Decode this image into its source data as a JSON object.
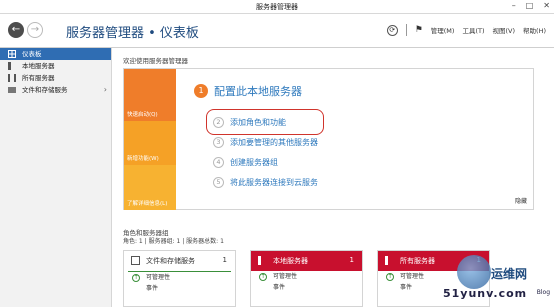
{
  "window": {
    "title": "服务器管理器",
    "controls": [
      "–",
      "□",
      "✕"
    ]
  },
  "header": {
    "back": "←",
    "forward": "→",
    "breadcrumb": "服务器管理器 • 仪表板",
    "menus": [
      "管理(M)",
      "工具(T)",
      "视图(V)",
      "帮助(H)"
    ]
  },
  "sidebar": {
    "items": [
      {
        "label": "仪表板",
        "icon": "dashboard-icon"
      },
      {
        "label": "本地服务器",
        "icon": "server-icon"
      },
      {
        "label": "所有服务器",
        "icon": "servers-icon"
      },
      {
        "label": "文件和存储服务",
        "icon": "folder-icon"
      }
    ]
  },
  "welcome": {
    "title": "欢迎使用服务器管理器",
    "quadrants": [
      "快速启动(Q)",
      "新增功能(W)",
      "了解详细信息(L)"
    ],
    "step_main": {
      "num": "1",
      "label": "配置此本地服务器"
    },
    "steps": [
      {
        "num": "2",
        "label": "添加角色和功能"
      },
      {
        "num": "3",
        "label": "添加要管理的其他服务器"
      },
      {
        "num": "4",
        "label": "创建服务器组"
      },
      {
        "num": "5",
        "label": "将此服务器连接到云服务"
      }
    ],
    "hide": "隐藏"
  },
  "roles": {
    "title": "角色和服务器组",
    "subtitle": "角色: 1 | 服务器组: 1 | 服务器总数: 1",
    "tiles": [
      {
        "title": "文件和存储服务",
        "count": "1",
        "rows": [
          "可管理性",
          "事件"
        ],
        "style": "plain"
      },
      {
        "title": "本地服务器",
        "count": "1",
        "rows": [
          "可管理性",
          "事件"
        ],
        "style": "red"
      },
      {
        "title": "所有服务器",
        "count": "1",
        "rows": [
          "可管理性",
          "事件"
        ],
        "style": "red"
      }
    ]
  },
  "watermark": {
    "text": "运维网",
    "domain": "51yunv.com",
    "blog": "Blog"
  },
  "colors": {
    "accent_blue": "#2e79bd",
    "orange": "#ef7d2a",
    "red": "#c8102e",
    "highlight": "#d0342c"
  }
}
